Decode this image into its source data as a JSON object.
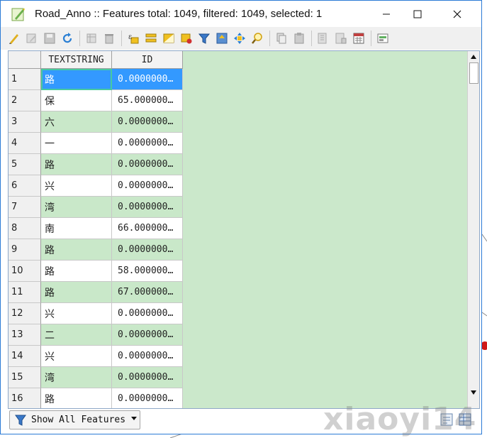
{
  "window": {
    "title": "Road_Anno :: Features total: 1049, filtered: 1049, selected: 1"
  },
  "toolbar": {
    "icons": [
      "pencil-edit-icon",
      "multi-edit-icon",
      "save-icon",
      "reload-icon",
      "delete-column-icon",
      "delete-feature-icon",
      "expression-select-icon",
      "select-all-icon",
      "invert-selection-icon",
      "deselect-icon",
      "filter-select-icon",
      "move-to-top-icon",
      "pan-to-selection-icon",
      "zoom-to-selection-icon",
      "copy-icon",
      "paste-icon",
      "new-field-icon",
      "delete-field-icon",
      "field-calculator-icon",
      "conditional-format-icon"
    ]
  },
  "table": {
    "columns": [
      "TEXTSTRING",
      "ID"
    ],
    "rows": [
      {
        "n": "1",
        "text": "路",
        "id": "0.0000000…"
      },
      {
        "n": "2",
        "text": "保",
        "id": "65.000000…"
      },
      {
        "n": "3",
        "text": "六",
        "id": "0.0000000…"
      },
      {
        "n": "4",
        "text": "一",
        "id": "0.0000000…"
      },
      {
        "n": "5",
        "text": "路",
        "id": "0.0000000…"
      },
      {
        "n": "6",
        "text": "兴",
        "id": "0.0000000…"
      },
      {
        "n": "7",
        "text": "湾",
        "id": "0.0000000…"
      },
      {
        "n": "8",
        "text": "南",
        "id": "66.000000…"
      },
      {
        "n": "9",
        "text": "路",
        "id": "0.0000000…"
      },
      {
        "n": "10",
        "text": "路",
        "id": "58.000000…"
      },
      {
        "n": "11",
        "text": "路",
        "id": "67.000000…"
      },
      {
        "n": "12",
        "text": "兴",
        "id": "0.0000000…"
      },
      {
        "n": "13",
        "text": "二",
        "id": "0.0000000…"
      },
      {
        "n": "14",
        "text": "兴",
        "id": "0.0000000…"
      },
      {
        "n": "15",
        "text": "湾",
        "id": "0.0000000…"
      },
      {
        "n": "16",
        "text": "路",
        "id": "0.0000000…"
      }
    ],
    "selected_row": 1
  },
  "bottom": {
    "filter_label": "Show All Features"
  },
  "watermark": "xiaoyi14",
  "colors": {
    "accent": "#3399ff",
    "alt_row": "#c9e8c9",
    "window_border": "#2b7bd6"
  }
}
